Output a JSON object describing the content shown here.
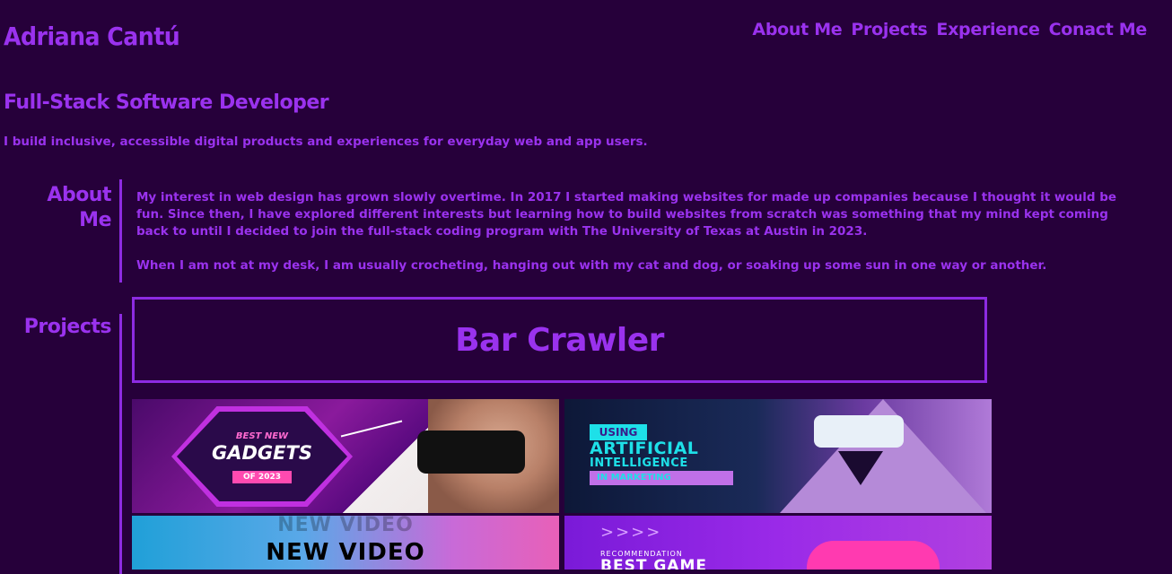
{
  "header": {
    "name": "Adriana Cantú",
    "nav": [
      "About Me",
      "Projects",
      "Experience",
      "Conact Me"
    ]
  },
  "hero": {
    "subtitle": "Full-Stack Software Developer",
    "tagline": "I build inclusive, accessible digital products and experiences for everyday web and app users."
  },
  "about": {
    "title": "About Me",
    "paragraphs": [
      "My interest in web design has grown slowly overtime. In 2017 I started making websites for made up companies because I thought it would be fun. Since then, I have explored different interests but learning how to build websites from scratch was something that my mind kept coming back to until I decided to join the full-stack coding program with The University of Texas at Austin in 2023.",
      "When I am not at my desk, I am usually crocheting, hanging out with my cat and dog, or soaking up some sun in one way or another."
    ]
  },
  "projects": {
    "title": "Projects",
    "featured": "Bar Crawler",
    "tiles": [
      {
        "small": "BEST NEW",
        "big": "GADGETS",
        "year": "OF 2023"
      },
      {
        "using": "USING",
        "big": "ARTIFICIAL",
        "mid": "INTELLIGENCE",
        "bar": "IN MARKETING"
      },
      {
        "ghost": "NEW VIDEO",
        "main": "NEW VIDEO"
      },
      {
        "arrows": ">>>>",
        "small": "RECOMMENDATION",
        "big": "BEST GAME"
      }
    ]
  }
}
